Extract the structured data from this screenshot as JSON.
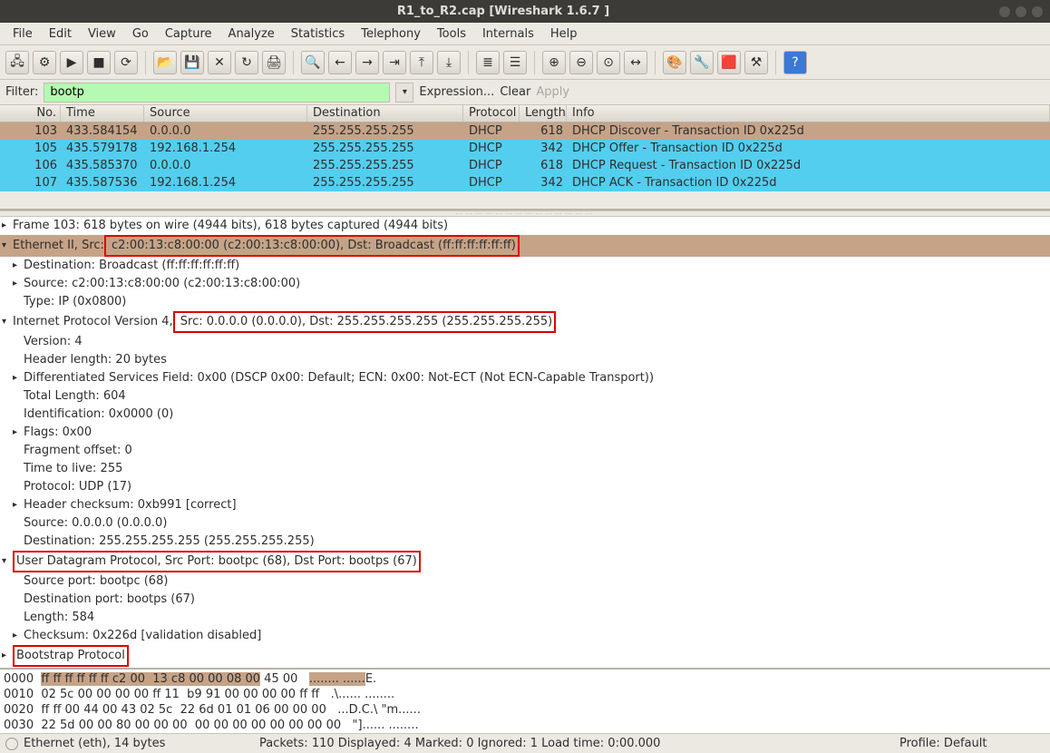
{
  "title": "R1_to_R2.cap   [Wireshark 1.6.7 ]",
  "menu": [
    "File",
    "Edit",
    "View",
    "Go",
    "Capture",
    "Analyze",
    "Statistics",
    "Telephony",
    "Tools",
    "Internals",
    "Help"
  ],
  "filter": {
    "label": "Filter:",
    "value": "bootp",
    "expression": "Expression...",
    "clear": "Clear",
    "apply": "Apply"
  },
  "columns": {
    "no": "No.",
    "time": "Time",
    "source": "Source",
    "destination": "Destination",
    "protocol": "Protocol",
    "length": "Length",
    "info": "Info"
  },
  "packets": [
    {
      "no": "103",
      "time": "433.584154",
      "src": "0.0.0.0",
      "dst": "255.255.255.255",
      "proto": "DHCP",
      "len": "618",
      "info": "DHCP Discover - Transaction ID 0x225d",
      "sel": true
    },
    {
      "no": "105",
      "time": "435.579178",
      "src": "192.168.1.254",
      "dst": "255.255.255.255",
      "proto": "DHCP",
      "len": "342",
      "info": "DHCP Offer    - Transaction ID 0x225d",
      "hl": true
    },
    {
      "no": "106",
      "time": "435.585370",
      "src": "0.0.0.0",
      "dst": "255.255.255.255",
      "proto": "DHCP",
      "len": "618",
      "info": "DHCP Request  - Transaction ID 0x225d",
      "hl": true
    },
    {
      "no": "107",
      "time": "435.587536",
      "src": "192.168.1.254",
      "dst": "255.255.255.255",
      "proto": "DHCP",
      "len": "342",
      "info": "DHCP ACK      - Transaction ID 0x225d",
      "hl": true
    }
  ],
  "details": {
    "frame": "Frame 103: 618 bytes on wire (4944 bits), 618 bytes captured (4944 bits)",
    "eth_pre": "Ethernet II, Src:",
    "eth_box": " c2:00:13:c8:00:00 (c2:00:13:c8:00:00), Dst: Broadcast (ff:ff:ff:ff:ff:ff)",
    "eth_dst": "Destination: Broadcast (ff:ff:ff:ff:ff:ff)",
    "eth_src": "Source: c2:00:13:c8:00:00 (c2:00:13:c8:00:00)",
    "eth_type": "Type: IP (0x0800)",
    "ip_pre": "Internet Protocol Version 4,",
    "ip_box": " Src: 0.0.0.0 (0.0.0.0), Dst: 255.255.255.255 (255.255.255.255)",
    "ip_ver": "Version: 4",
    "ip_hlen": "Header length: 20 bytes",
    "ip_dscp": "Differentiated Services Field: 0x00 (DSCP 0x00: Default; ECN: 0x00: Not-ECT (Not ECN-Capable Transport))",
    "ip_tlen": "Total Length: 604",
    "ip_id": "Identification: 0x0000 (0)",
    "ip_flags": "Flags: 0x00",
    "ip_frag": "Fragment offset: 0",
    "ip_ttl": "Time to live: 255",
    "ip_proto": "Protocol: UDP (17)",
    "ip_csum": "Header checksum: 0xb991 [correct]",
    "ip_src": "Source: 0.0.0.0 (0.0.0.0)",
    "ip_dst": "Destination: 255.255.255.255 (255.255.255.255)",
    "udp_box": "User Datagram Protocol, Src Port: bootpc (68), Dst Port: bootps (67)",
    "udp_sp": "Source port: bootpc (68)",
    "udp_dp": "Destination port: bootps (67)",
    "udp_len": "Length: 584",
    "udp_csum": "Checksum: 0x226d [validation disabled]",
    "boot_box": "Bootstrap Protocol"
  },
  "hex": {
    "r0_off": "0000",
    "r0_selhex": "ff ff ff ff ff ff c2 00  13 c8 00 00 08 00",
    "r0_rest": " 45 00",
    "r0_aseldots": "........ ......",
    "r0_arest": "E.",
    "r1_off": "0010",
    "r1_hex": "02 5c 00 00 00 00 ff 11  b9 91 00 00 00 00 ff ff",
    "r1_ascii": ".\\...... ........",
    "r2_off": "0020",
    "r2_hex": "ff ff 00 44 00 43 02 5c  22 6d 01 01 06 00 00 00",
    "r2_ascii": "...D.C.\\ \"m......",
    "r3_off": "0030",
    "r3_hex": "22 5d 00 00 80 00 00 00  00 00 00 00 00 00 00 00",
    "r3_ascii": "\"]...... ........"
  },
  "status": {
    "left": "Ethernet (eth), 14 bytes",
    "center": "Packets: 110 Displayed: 4 Marked: 0 Ignored: 1 Load time: 0:00.000",
    "right": "Profile: Default"
  }
}
